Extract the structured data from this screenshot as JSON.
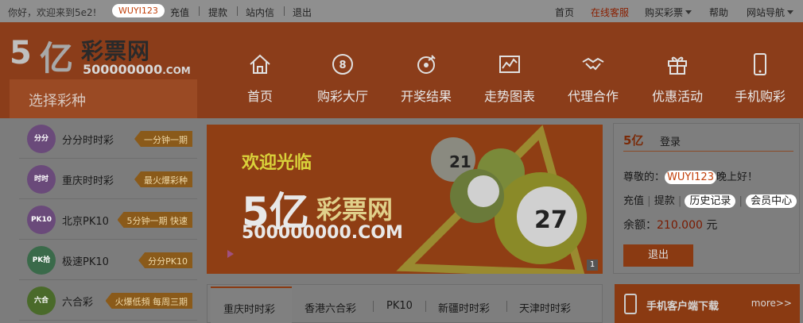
{
  "topbar": {
    "welcome": "你好，欢迎来到5e2!",
    "username": "WUYI123",
    "links": [
      "充值",
      "提款",
      "站内信",
      "退出"
    ],
    "right_links": {
      "home": "首页",
      "service": "在线客服",
      "buy": "购买彩票",
      "help": "帮助",
      "sitenav": "网站导航"
    }
  },
  "logo": {
    "five": "5",
    "yi": "亿",
    "brand": "彩票网",
    "url_main": "500000000",
    "url_suffix": ".COM"
  },
  "select_label": "选择彩种",
  "nav": [
    {
      "label": "首页",
      "icon": "home-icon"
    },
    {
      "label": "购彩大厅",
      "icon": "lottery-ball-icon"
    },
    {
      "label": "开奖结果",
      "icon": "draw-result-icon"
    },
    {
      "label": "走势图表",
      "icon": "chart-icon"
    },
    {
      "label": "代理合作",
      "icon": "handshake-icon"
    },
    {
      "label": "优惠活动",
      "icon": "gift-icon"
    },
    {
      "label": "手机购彩",
      "icon": "mobile-icon"
    }
  ],
  "lotteries": [
    {
      "name": "分分时时彩",
      "tag": "一分钟一期",
      "badge": "分分",
      "color": "#6a4a7a"
    },
    {
      "name": "重庆时时彩",
      "tag": "最火爆彩种",
      "badge": "时时",
      "color": "#6a4a7a"
    },
    {
      "name": "北京PK10",
      "tag": "5分钟一期 快速",
      "badge": "PK10",
      "color": "#6a4a7a"
    },
    {
      "name": "极速PK10",
      "tag": "分分PK10",
      "badge": "PK拾",
      "color": "#3a6a4a"
    },
    {
      "name": "六合彩",
      "tag": "火爆低頻 每周三期",
      "badge": "六合",
      "color": "#4a6a2a"
    }
  ],
  "banner": {
    "welcome": "欢迎光临",
    "brand_big": "5亿",
    "brand_cn": "彩票网",
    "url": "500000000.COM",
    "page": "1",
    "balls": [
      "21",
      "27"
    ]
  },
  "login": {
    "logo": "5亿",
    "title": "登录",
    "greet_prefix": "尊敬的：",
    "username": "WUYI123",
    "greet_suffix": "晚上好！",
    "recharge": "充值",
    "withdraw": "提款",
    "history": "历史记录",
    "member": "会员中心",
    "balance_label": "余额：",
    "balance_value": "210.000",
    "balance_unit": "元",
    "logout": "退出"
  },
  "tabs": [
    "重庆时时彩",
    "香港六合彩",
    "PK10",
    "新疆时时彩",
    "天津时时彩"
  ],
  "mobile": {
    "text": "手机客户端下载",
    "more": "more>>"
  }
}
